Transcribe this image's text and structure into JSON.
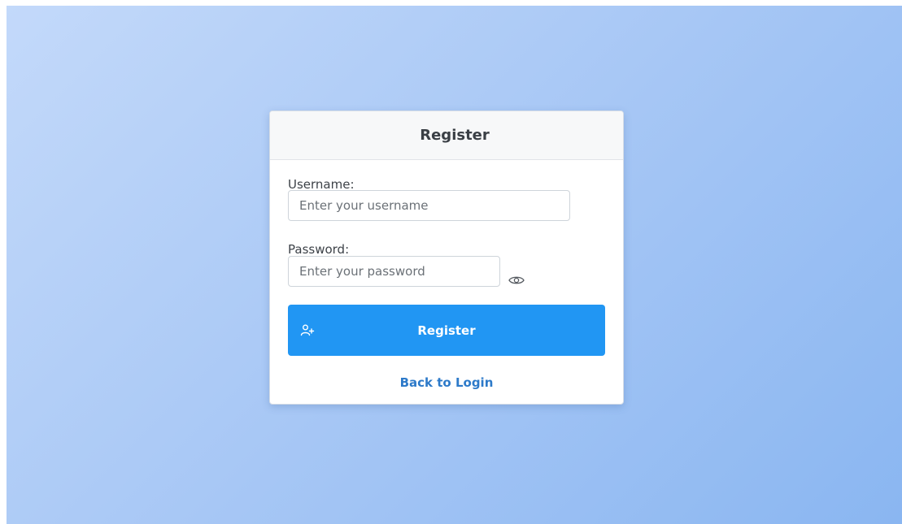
{
  "page": {
    "background_gradient": [
      "#c3d9fa",
      "#8ab6f1"
    ]
  },
  "card": {
    "title": "Register",
    "username": {
      "label": "Username:",
      "placeholder": "Enter your username",
      "value": ""
    },
    "password": {
      "label": "Password:",
      "placeholder": "Enter your password",
      "value": "",
      "toggle_icon": "eye-icon"
    },
    "register_button": {
      "label": "Register",
      "icon": "user-plus-icon",
      "color": "#2196f3"
    },
    "back_link": {
      "label": "Back to Login",
      "color": "#2d7ac9"
    }
  }
}
